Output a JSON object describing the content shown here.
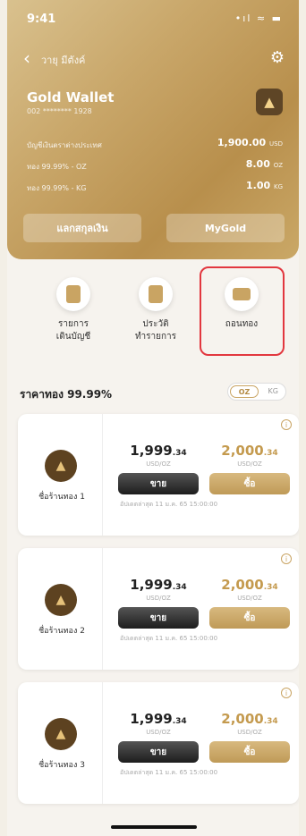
{
  "status_bar": {
    "time": "9:41",
    "icons": "•ıl ≈ ▬"
  },
  "header": {
    "back_label": "วายุ มีตังค์",
    "title": "Gold Wallet",
    "account_no": "002 ******** 1928",
    "rows": [
      {
        "label": "บัญชีเงินตราต่างประเทศ",
        "value": "1,900.00",
        "unit": "USD"
      },
      {
        "label": "ทอง 99.99% - OZ",
        "value": "8.00",
        "unit": "OZ"
      },
      {
        "label": "ทอง 99.99% - KG",
        "value": "1.00",
        "unit": "KG"
      }
    ],
    "btn_exchange": "แลกสกุลเงิน",
    "btn_mygold": "MyGold"
  },
  "actions": [
    {
      "label_line1": "รายการ",
      "label_line2": "เดินบัญชี"
    },
    {
      "label_line1": "ประวัติ",
      "label_line2": "ทำรายการ"
    },
    {
      "label_line1": "ถอนทอง",
      "label_line2": ""
    }
  ],
  "price_section": {
    "title": "ราคาทอง 99.99%",
    "toggle_oz": "OZ",
    "toggle_kg": "KG"
  },
  "shops": [
    {
      "name": "ชื่อร้านทอง 1",
      "sell_main": "1,999",
      "sell_dec": ".34",
      "buy_main": "2,000",
      "buy_dec": ".34",
      "unit": "USD/OZ",
      "sell_label": "ขาย",
      "buy_label": "ซื้อ",
      "updated": "อัปเดตล่าสุด 11 ม.ค. 65 15:00:00"
    },
    {
      "name": "ชื่อร้านทอง 2",
      "sell_main": "1,999",
      "sell_dec": ".34",
      "buy_main": "2,000",
      "buy_dec": ".34",
      "unit": "USD/OZ",
      "sell_label": "ขาย",
      "buy_label": "ซื้อ",
      "updated": "อัปเดตล่าสุด 11 ม.ค. 65 15:00:00"
    },
    {
      "name": "ชื่อร้านทอง 3",
      "sell_main": "1,999",
      "sell_dec": ".34",
      "buy_main": "2,000",
      "buy_dec": ".34",
      "unit": "USD/OZ",
      "sell_label": "ขาย",
      "buy_label": "ซื้อ",
      "updated": "อัปเดตล่าสุด 11 ม.ค. 65 15:00:00"
    }
  ]
}
